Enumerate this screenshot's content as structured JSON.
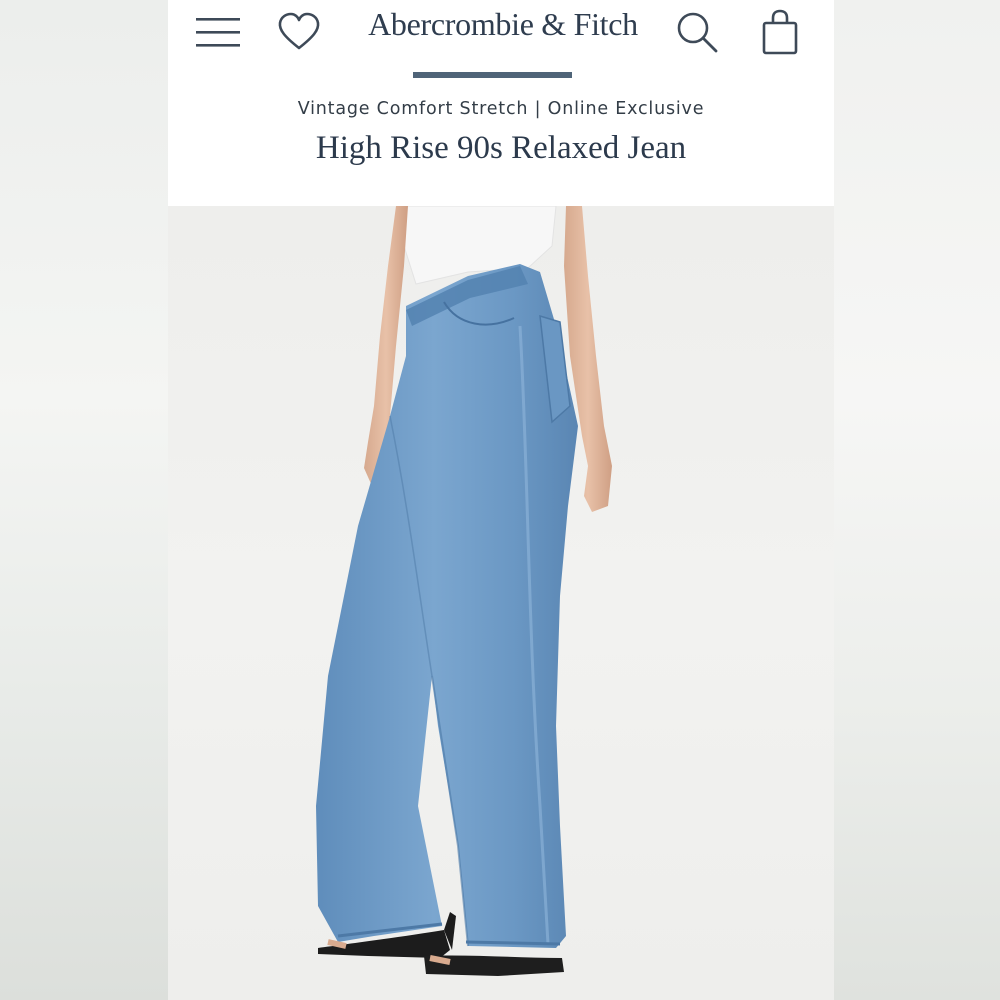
{
  "header": {
    "brand_name": "Abercrombie & Fitch",
    "icons": [
      "menu-icon",
      "heart-icon",
      "search-icon",
      "shopping-bag-icon"
    ],
    "accent_color": "#4f6478"
  },
  "product": {
    "collection_label": "Vintage Comfort Stretch | Online Exclusive",
    "title": "High Rise 90s Relaxed Jean"
  },
  "colors": {
    "text_primary": "#2f3d4f",
    "denim": "#6d9ac4",
    "background": "#ffffff"
  }
}
